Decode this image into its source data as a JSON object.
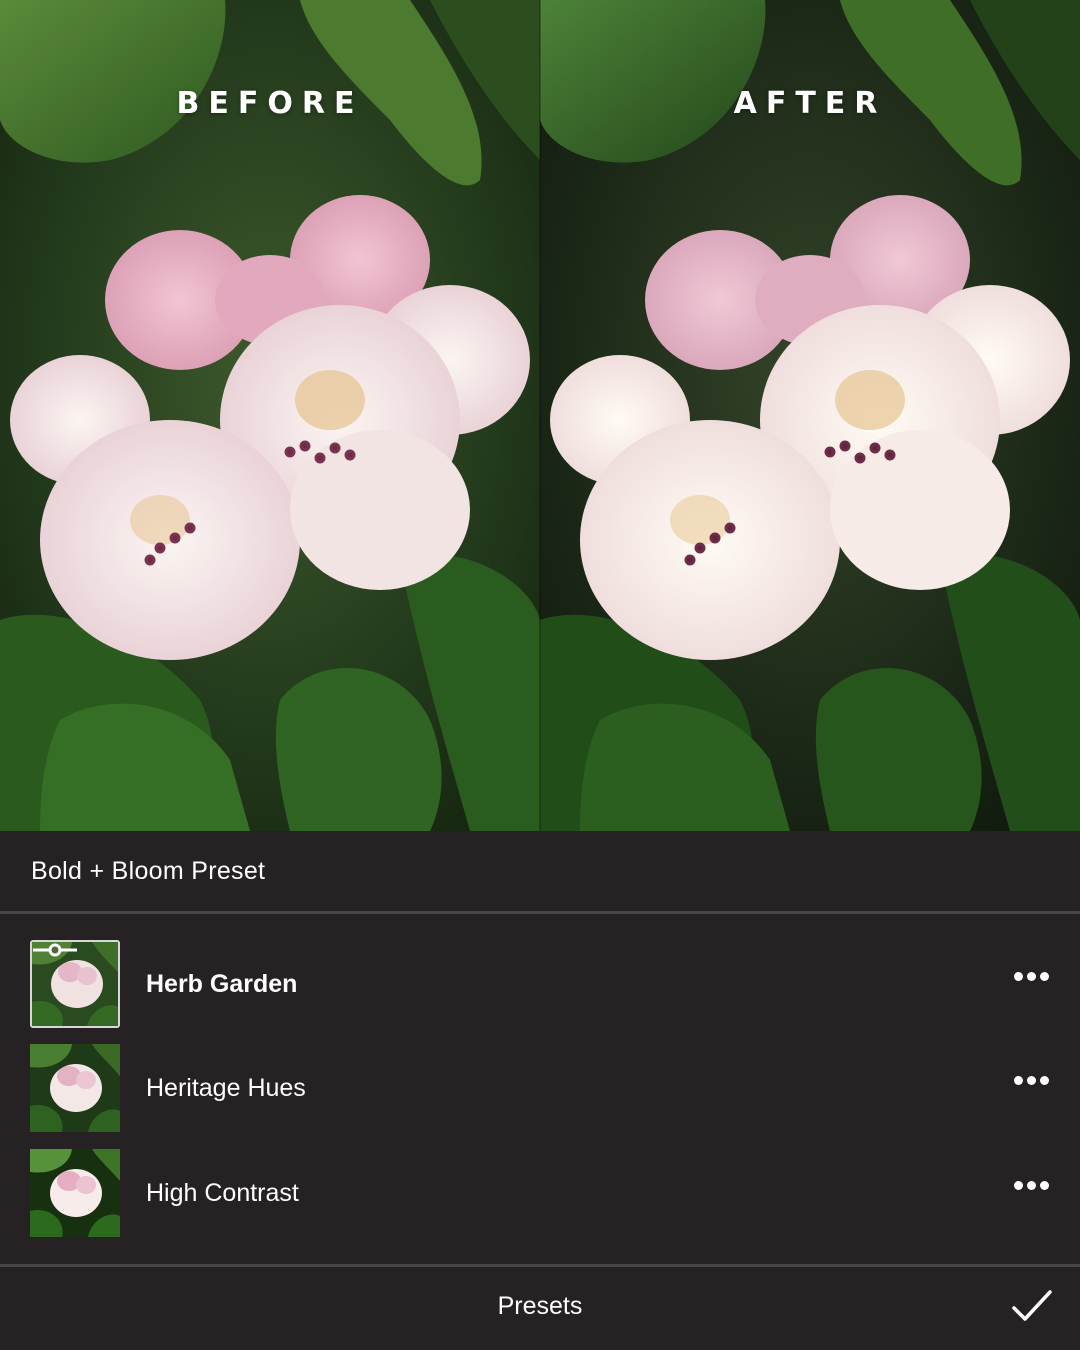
{
  "comparison": {
    "before_label": "BEFORE",
    "after_label": "AFTER"
  },
  "panel": {
    "title": "Bold + Bloom Preset",
    "presets": [
      {
        "name": "Herb Garden",
        "selected": true,
        "icon": "slider-adjust-icon"
      },
      {
        "name": "Heritage Hues",
        "selected": false
      },
      {
        "name": "High Contrast",
        "selected": false
      }
    ],
    "footer_label": "Presets",
    "confirm_icon": "checkmark-icon",
    "more_icon": "more-options-icon"
  },
  "colors": {
    "panel_background": "#262223",
    "separator": "#4a4647",
    "text": "#ffffff"
  }
}
